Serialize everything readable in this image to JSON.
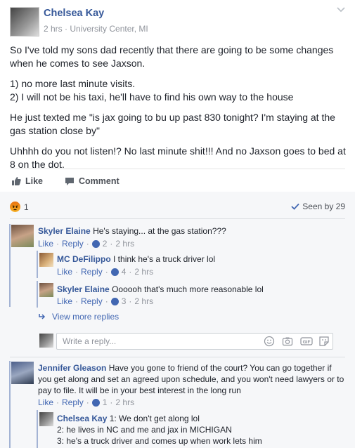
{
  "post": {
    "author": "Chelsea Kay",
    "meta": "2 hrs · University Center, MI",
    "paragraphs": [
      "So I've told my sons dad recently that there are going to be some changes when he comes to see Jaxson.",
      "1) no more last minute visits.",
      "2) I will not be his taxi, he'll have to find his own way to the house",
      "He just texted me \"is jax going to bu up past 830 tonight? I'm staying at the gas station close by\"",
      "Uhhhh do you not listen!? No last minute shit!!! And no Jaxson goes to bed at 8 on the dot."
    ],
    "like_label": "Like",
    "comment_label": "Comment",
    "reaction_count": "1",
    "seen_by": "Seen by 29"
  },
  "comments": [
    {
      "name": "Skyler Elaine",
      "text": "He's staying... at the gas station???",
      "like": "Like",
      "reply": "Reply",
      "likes": "2",
      "time": "2 hrs"
    },
    {
      "name": "MC DeFilippo",
      "text": "I think he's a truck driver lol",
      "like": "Like",
      "reply": "Reply",
      "likes": "4",
      "time": "2 hrs"
    },
    {
      "name": "Skyler Elaine",
      "text": "Oooooh that's much more reasonable lol",
      "like": "Like",
      "reply": "Reply",
      "likes": "3",
      "time": "2 hrs"
    },
    {
      "name": "Jennifer Gleason",
      "text": "Have you gone to friend of the court? You can go together if you get along and set an agreed upon schedule, and you won't need lawyers or to pay to file. It will be in your best interest in the long run",
      "like": "Like",
      "reply": "Reply",
      "likes": "1",
      "time": "2 hrs"
    },
    {
      "name": "Chelsea Kay",
      "line1": "1: We don't get along lol",
      "line2": "2: he lives in NC and me and jax in MICHIGAN",
      "line3": "3: he's a truck driver and comes up when work lets him"
    }
  ],
  "view_more": "View more replies",
  "reply_placeholder": "Write a reply...",
  "colors": {
    "link": "#365899",
    "accent": "#4267b2",
    "muted": "#90949c"
  }
}
